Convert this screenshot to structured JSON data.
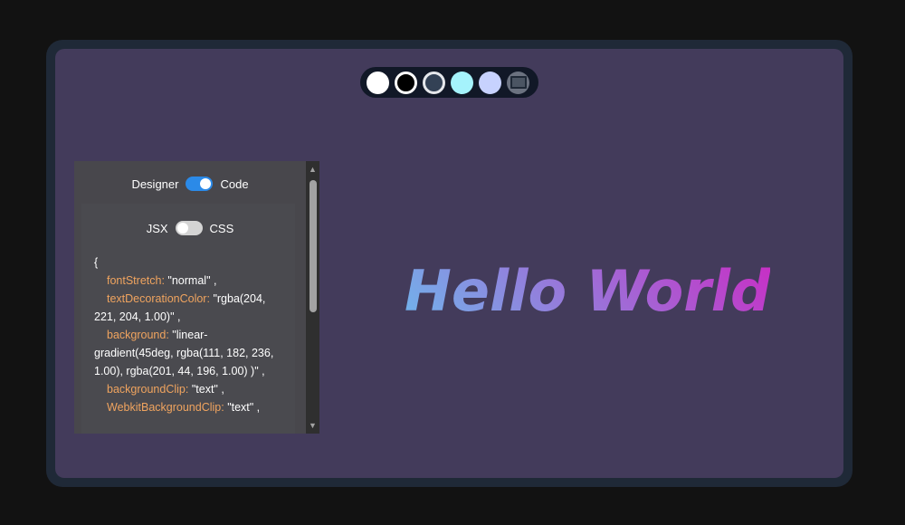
{
  "swatches": [
    {
      "name": "white",
      "color": "#ffffff"
    },
    {
      "name": "black",
      "color": "#000000"
    },
    {
      "name": "slate",
      "color": "#334155"
    },
    {
      "name": "cyan",
      "color": "#a5f3fc"
    },
    {
      "name": "lavender",
      "color": "#c7d2fe"
    },
    {
      "name": "gray",
      "color": "#6b7280"
    }
  ],
  "mode_toggle": {
    "left_label": "Designer",
    "right_label": "Code",
    "state": "Code"
  },
  "syntax_toggle": {
    "left_label": "JSX",
    "right_label": "CSS",
    "state": "JSX"
  },
  "code": {
    "open_brace": "{",
    "props": [
      {
        "key": "fontStretch:",
        "value": "\"normal\" ,"
      },
      {
        "key": "textDecorationColor:",
        "value": "\"rgba(204, 221, 204, 1.00)\" ,"
      },
      {
        "key": "background:",
        "value": "\"linear-gradient(45deg, rgba(111, 182, 236, 1.00), rgba(201, 44, 196, 1.00) )\" ,"
      },
      {
        "key": "backgroundClip:",
        "value": "\"text\" ,"
      },
      {
        "key": "WebkitBackgroundClip:",
        "value": "\"text\" ,"
      }
    ]
  },
  "preview": {
    "text": "Hello World"
  },
  "colors": {
    "page_bg": "#121212",
    "frame": "#1f2937",
    "canvas": "#433b5b",
    "panel": "#48474c",
    "toggle_on": "#2b8ae8",
    "code_key": "#f0a45f",
    "gradient_start": "#6fb6ec",
    "gradient_end": "#c92cc4"
  }
}
